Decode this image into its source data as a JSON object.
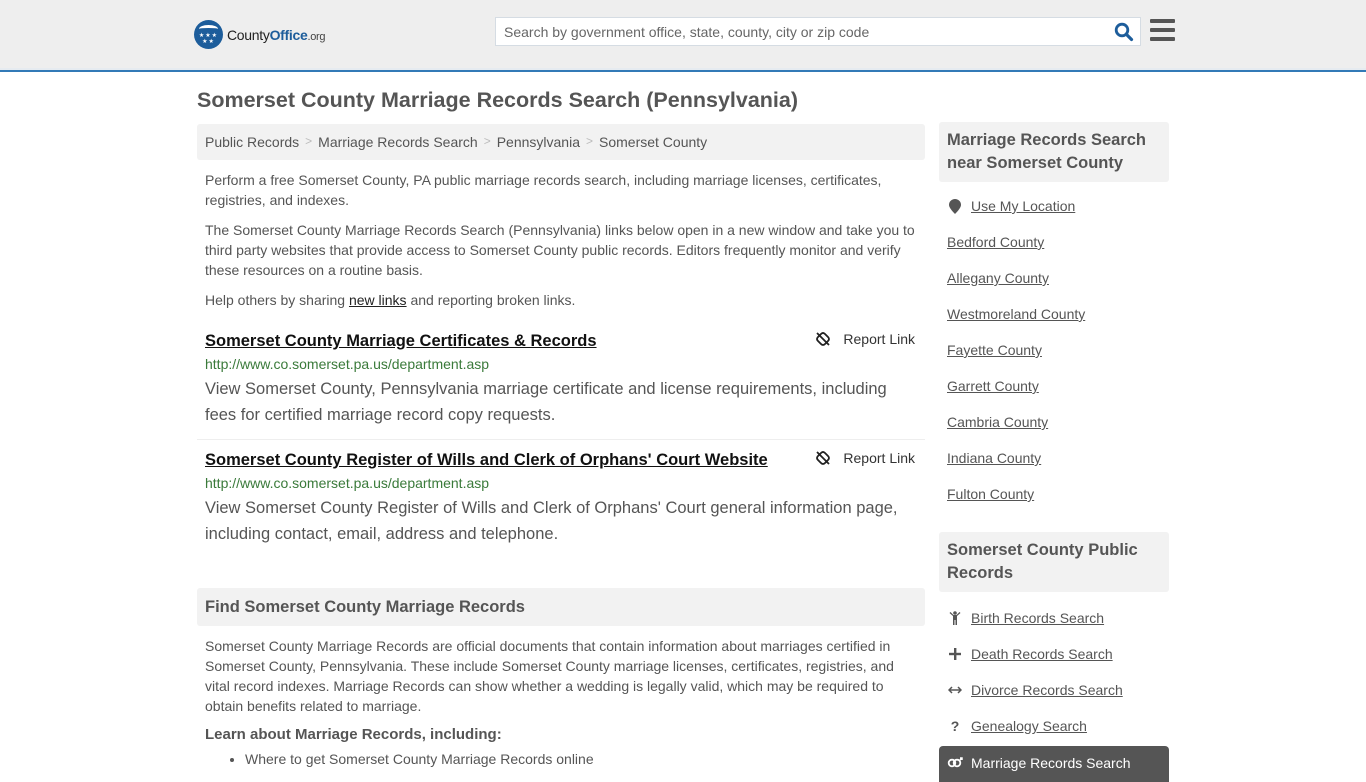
{
  "header": {
    "logo": {
      "county": "County",
      "office": "Office",
      "org": ".org",
      "stars": "★★★ ★★"
    },
    "search": {
      "placeholder": "Search by government office, state, county, city or zip code",
      "value": ""
    }
  },
  "page_title": "Somerset County Marriage Records Search (Pennsylvania)",
  "breadcrumb": [
    "Public Records",
    "Marriage Records Search",
    "Pennsylvania",
    "Somerset County"
  ],
  "breadcrumb_separator": ">",
  "intro": {
    "p1": "Perform a free Somerset County, PA public marriage records search, including marriage licenses, certificates, registries, and indexes.",
    "p2": "The Somerset County Marriage Records Search (Pennsylvania) links below open in a new window and take you to third party websites that provide access to Somerset County public records. Editors frequently monitor and verify these resources on a routine basis.",
    "p3_before": "Help others by sharing ",
    "p3_link": "new links",
    "p3_after": " and reporting broken links."
  },
  "results": [
    {
      "title": "Somerset County Marriage Certificates & Records",
      "url": "http://www.co.somerset.pa.us/department.asp",
      "description": "View Somerset County, Pennsylvania marriage certificate and license requirements, including fees for certified marriage record copy requests.",
      "report_label": "Report Link"
    },
    {
      "title": "Somerset County Register of Wills and Clerk of Orphans' Court Website",
      "url": "http://www.co.somerset.pa.us/department.asp",
      "description": "View Somerset County Register of Wills and Clerk of Orphans' Court general information page, including contact, email, address and telephone.",
      "report_label": "Report Link"
    }
  ],
  "find_section": {
    "heading": "Find Somerset County Marriage Records",
    "body": "Somerset County Marriage Records are official documents that contain information about marriages certified in Somerset County, Pennsylvania. These include Somerset County marriage licenses, certificates, registries, and vital record indexes. Marriage Records can show whether a wedding is legally valid, which may be required to obtain benefits related to marriage.",
    "subheading": "Learn about Marriage Records, including:",
    "bullets": [
      "Where to get Somerset County Marriage Records online"
    ]
  },
  "sidebar": {
    "near": {
      "heading": "Marriage Records Search near Somerset County",
      "use_location": "Use My Location",
      "counties": [
        "Bedford County",
        "Allegany County",
        "Westmoreland County",
        "Fayette County",
        "Garrett County",
        "Cambria County",
        "Indiana County",
        "Fulton County"
      ]
    },
    "public_records": {
      "heading": "Somerset County Public Records",
      "items": [
        {
          "label": "Birth Records Search",
          "icon": "child-icon"
        },
        {
          "label": "Death Records Search",
          "icon": "cross-icon"
        },
        {
          "label": "Divorce Records Search",
          "icon": "arrows-horizontal-icon"
        },
        {
          "label": "Genealogy Search",
          "icon": "question-icon"
        }
      ],
      "active": {
        "label": "Marriage Records Search",
        "icon": "marriage-icon"
      }
    }
  },
  "colors": {
    "brand": "#1d5d9b",
    "header_border": "#337ab7",
    "url_green": "#3a7a3a",
    "active_bg": "#555555"
  }
}
